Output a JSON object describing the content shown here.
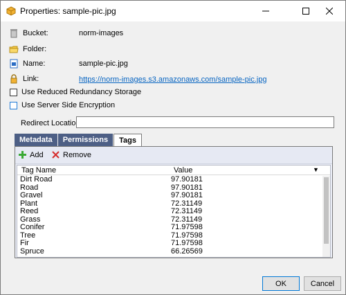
{
  "window": {
    "title": "Properties: sample-pic.jpg",
    "accent": "#4d5f85"
  },
  "fields": {
    "bucket_label": "Bucket:",
    "bucket_value": "norm-images",
    "folder_label": "Folder:",
    "name_label": "Name:",
    "name_value": "sample-pic.jpg",
    "link_label": "Link:",
    "link_value": "https://norm-images.s3.amazonaws.com/sample-pic.jpg"
  },
  "options": {
    "reduced_redundancy": "Use Reduced Redundancy Storage",
    "sse": "Use Server Side Encryption"
  },
  "redirect": {
    "label": "Redirect Location:",
    "value": ""
  },
  "tabs": [
    "Metadata",
    "Permissions",
    "Tags"
  ],
  "active_tab": "Tags",
  "toolbar": {
    "add_label": "Add",
    "remove_label": "Remove"
  },
  "grid": {
    "columns": [
      "Tag Name",
      "Value"
    ],
    "rows": [
      [
        "Dirt Road",
        "97.90181"
      ],
      [
        "Road",
        "97.90181"
      ],
      [
        "Gravel",
        "97.90181"
      ],
      [
        "Plant",
        "72.31149"
      ],
      [
        "Reed",
        "72.31149"
      ],
      [
        "Grass",
        "72.31149"
      ],
      [
        "Conifer",
        "71.97598"
      ],
      [
        "Tree",
        "71.97598"
      ],
      [
        "Fir",
        "71.97598"
      ],
      [
        "Spruce",
        "66.26569"
      ]
    ]
  },
  "buttons": {
    "ok": "OK",
    "cancel": "Cancel"
  }
}
